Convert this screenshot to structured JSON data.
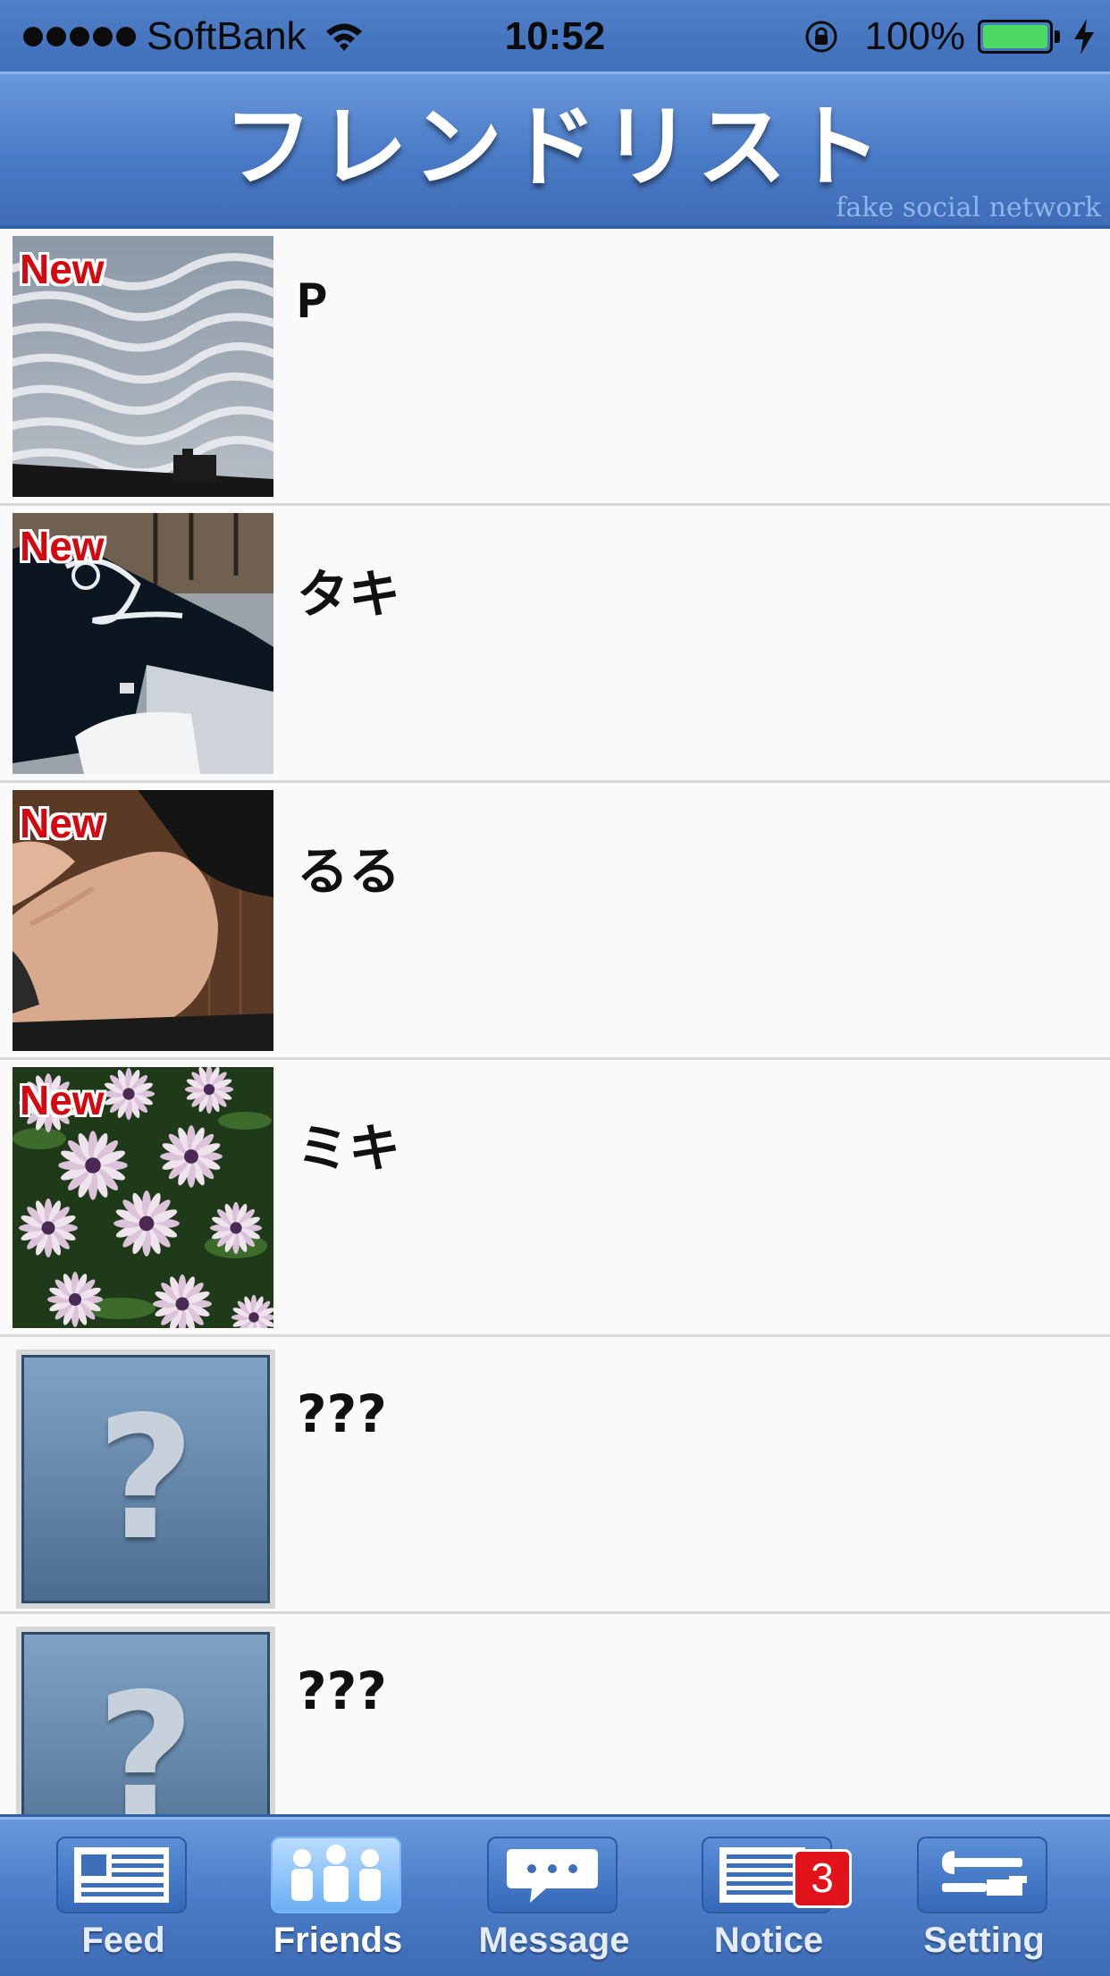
{
  "status_bar": {
    "carrier": "SoftBank",
    "time": "10:52",
    "battery_percent": "100%",
    "battery_level": 1.0
  },
  "header": {
    "title": "フレンドリスト",
    "watermark": "fake social network"
  },
  "friends": [
    {
      "name": "P",
      "badge": "New",
      "photo": "rippled-clouds-sky"
    },
    {
      "name": "タキ",
      "badge": "New",
      "photo": "black-car-street"
    },
    {
      "name": "るる",
      "badge": "New",
      "photo": "legs-hand-closeup"
    },
    {
      "name": "ミキ",
      "badge": "New",
      "photo": "pink-white-daisies"
    },
    {
      "name": "???",
      "placeholder": "?"
    },
    {
      "name": "???",
      "placeholder": "?"
    }
  ],
  "tabbar": {
    "tabs": [
      {
        "label": "Feed",
        "icon": "feed-icon"
      },
      {
        "label": "Friends",
        "icon": "friends-icon",
        "active": true
      },
      {
        "label": "Message",
        "icon": "message-icon"
      },
      {
        "label": "Notice",
        "icon": "notice-icon",
        "badge": "3"
      },
      {
        "label": "Setting",
        "icon": "setting-icon"
      }
    ]
  },
  "colors": {
    "header_blue": "#4a7bc6",
    "new_badge": "#d6080f",
    "notice_badge": "#e1121a",
    "battery_green": "#4cd964"
  }
}
